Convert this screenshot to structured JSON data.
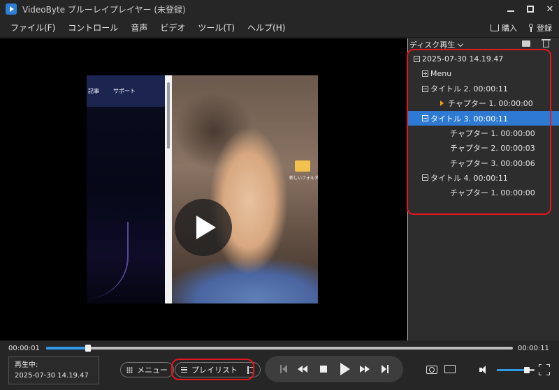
{
  "window": {
    "title": "VideoByte ブルーレイプレイヤー (未登録)",
    "min_label": "",
    "close_label": "✕"
  },
  "menu": {
    "items": [
      "ファイル(F)",
      "コントロール",
      "音声",
      "ビデオ",
      "ツール(T)",
      "ヘルプ(H)"
    ],
    "buy_label": "購入",
    "register_label": "登録"
  },
  "video": {
    "web_nav_items": [
      "記事",
      "サポート"
    ],
    "folder_label": "新しいフォルダー"
  },
  "panel": {
    "header_label": "ディスク再生",
    "tree": [
      {
        "label": "2025-07-30 14.19.47",
        "level": 0,
        "toggle": "minus"
      },
      {
        "label": "Menu",
        "level": 1,
        "toggle": "plus"
      },
      {
        "label": "タイトル 2. 00:00:11",
        "level": 1,
        "toggle": "minus"
      },
      {
        "label": "チャプター 1. 00:00:00",
        "level": 2,
        "toggle": "playing"
      },
      {
        "label": "タイトル 3. 00:00:11",
        "level": 1,
        "toggle": "minus",
        "selected": true
      },
      {
        "label": "チャプター 1. 00:00:00",
        "level": 2,
        "toggle": "none"
      },
      {
        "label": "チャプター 2. 00:00:03",
        "level": 2,
        "toggle": "none"
      },
      {
        "label": "チャプター 3. 00:00:06",
        "level": 2,
        "toggle": "none"
      },
      {
        "label": "タイトル 4. 00:00:11",
        "level": 1,
        "toggle": "minus"
      },
      {
        "label": "チャプター 1. 00:00:00",
        "level": 2,
        "toggle": "none"
      }
    ]
  },
  "playback": {
    "current_time": "00:00:01",
    "total_time": "00:00:11",
    "progress_fraction": 0.09,
    "now_playing_label": "再生中:",
    "now_playing_value": "2025-07-30 14.19.47",
    "menu_button_label": "メニュー",
    "playlist_button_label": "プレイリスト",
    "volume_fraction": 0.8
  },
  "colors": {
    "accent": "#2e7ad3",
    "highlight_outline": "#e8141e",
    "progress": "#2e9ae8"
  },
  "icons": [
    "app-logo-icon",
    "minimize-icon",
    "maximize-icon",
    "close-icon",
    "cart-icon",
    "key-icon",
    "folder-open-icon",
    "trash-icon",
    "play-icon",
    "grid-icon",
    "list-icon",
    "sort-icon",
    "previous-icon",
    "rewind-icon",
    "stop-icon",
    "fast-forward-icon",
    "next-icon",
    "camera-icon",
    "folder-icon",
    "volume-icon",
    "fullscreen-icon"
  ]
}
